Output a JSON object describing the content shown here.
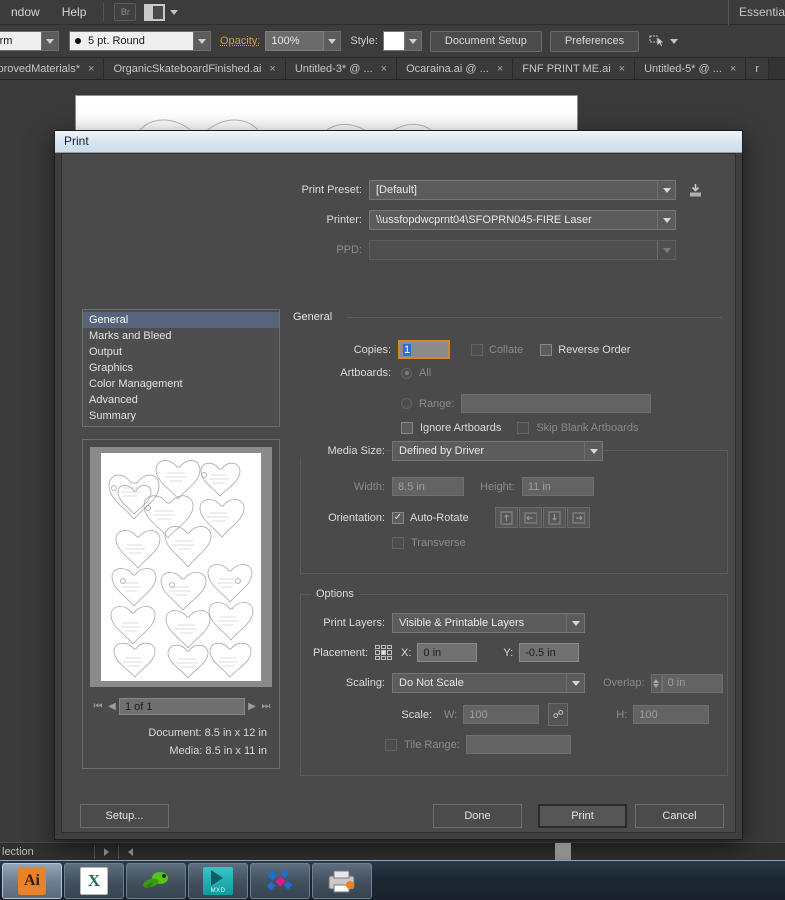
{
  "app": {
    "menus": [
      "ndow",
      "Help"
    ],
    "bridge_badge": "Br",
    "workspace_label": "Essentia",
    "controlbar": {
      "profile_value": "iform",
      "stroke_value": "5 pt. Round",
      "opacity_label": "Opacity:",
      "opacity_value": "100%",
      "style_label": "Style:",
      "document_setup": "Document Setup",
      "preferences": "Preferences"
    },
    "tabs": [
      {
        "label": "ApprovedMaterials*",
        "close": "×"
      },
      {
        "label": "OrganicSkateboardFinished.ai",
        "close": "×"
      },
      {
        "label": "Untitled-3* @ ...",
        "close": "×"
      },
      {
        "label": "Ocaraina.ai @ ...",
        "close": "×"
      },
      {
        "label": "FNF PRINT ME.ai",
        "close": "×"
      },
      {
        "label": "Untitled-5* @ ...",
        "close": "×"
      },
      {
        "label": "r",
        "close": ""
      }
    ],
    "statusbar": {
      "text": "lection"
    }
  },
  "dialog": {
    "title": "Print",
    "print_preset_label": "Print Preset:",
    "print_preset_value": "[Default]",
    "printer_label": "Printer:",
    "printer_value": "\\\\ussfopdwcprnt04\\SFOPRN045-FIRE Laser",
    "ppd_label": "PPD:",
    "ppd_value": "",
    "nav_items": [
      "General",
      "Marks and Bleed",
      "Output",
      "Graphics",
      "Color Management",
      "Advanced",
      "Summary"
    ],
    "nav_selected": "General",
    "section_title": "General",
    "general": {
      "copies_label": "Copies:",
      "copies_value": "1",
      "collate_label": "Collate",
      "reverse_order_label": "Reverse Order",
      "artboards_label": "Artboards:",
      "all_label": "All",
      "range_label": "Range:",
      "range_value": "",
      "ignore_artboards_label": "Ignore Artboards",
      "skip_blank_label": "Skip Blank Artboards"
    },
    "media": {
      "group_title": "",
      "media_size_label": "Media Size:",
      "media_size_value": "Defined by Driver",
      "width_label": "Width:",
      "width_value": "8.5 in",
      "height_label": "Height:",
      "height_value": "11 in",
      "orientation_label": "Orientation:",
      "auto_rotate_label": "Auto-Rotate",
      "auto_rotate_checked": "✓",
      "transverse_label": "Transverse"
    },
    "options": {
      "group_title": "Options",
      "print_layers_label": "Print Layers:",
      "print_layers_value": "Visible & Printable Layers",
      "placement_label": "Placement:",
      "x_label": "X:",
      "x_value": "0 in",
      "y_label": "Y:",
      "y_value": "-0.5 in",
      "scaling_label": "Scaling:",
      "scaling_value": "Do Not Scale",
      "overlap_label": "Overlap:",
      "overlap_value": "0 in",
      "scale_label": "Scale:",
      "scale_w_label": "W:",
      "scale_w_value": "100",
      "scale_h_label": "H:",
      "scale_h_value": "100",
      "tile_range_label": "Tile Range:",
      "tile_range_value": ""
    },
    "preview": {
      "page_value": "1 of 1",
      "first_icon": "⏮",
      "prev_icon": "◀",
      "next_icon": "▶",
      "last_icon": "⏭",
      "document_meta": "Document: 8.5 in x 12 in",
      "media_meta": "Media: 8.5 in x 11 in"
    },
    "buttons": {
      "setup": "Setup...",
      "done": "Done",
      "print": "Print",
      "cancel": "Cancel"
    }
  },
  "taskbar": {
    "items": [
      {
        "name": "illustrator",
        "label": "Ai",
        "active": true
      },
      {
        "name": "excel",
        "label": "X",
        "active": false
      },
      {
        "name": "green-app",
        "label": "",
        "active": false
      },
      {
        "name": "arcmap-mxd",
        "label": "MXD",
        "active": false
      },
      {
        "name": "diamonds-app",
        "label": "",
        "active": false
      },
      {
        "name": "printer-app",
        "label": "",
        "active": false
      }
    ]
  },
  "colors": {
    "accent": "#d18a2a",
    "selection": "#2a6ed6",
    "nav_selected": "#56657a",
    "dialog_bg": "#4a4a4a"
  }
}
